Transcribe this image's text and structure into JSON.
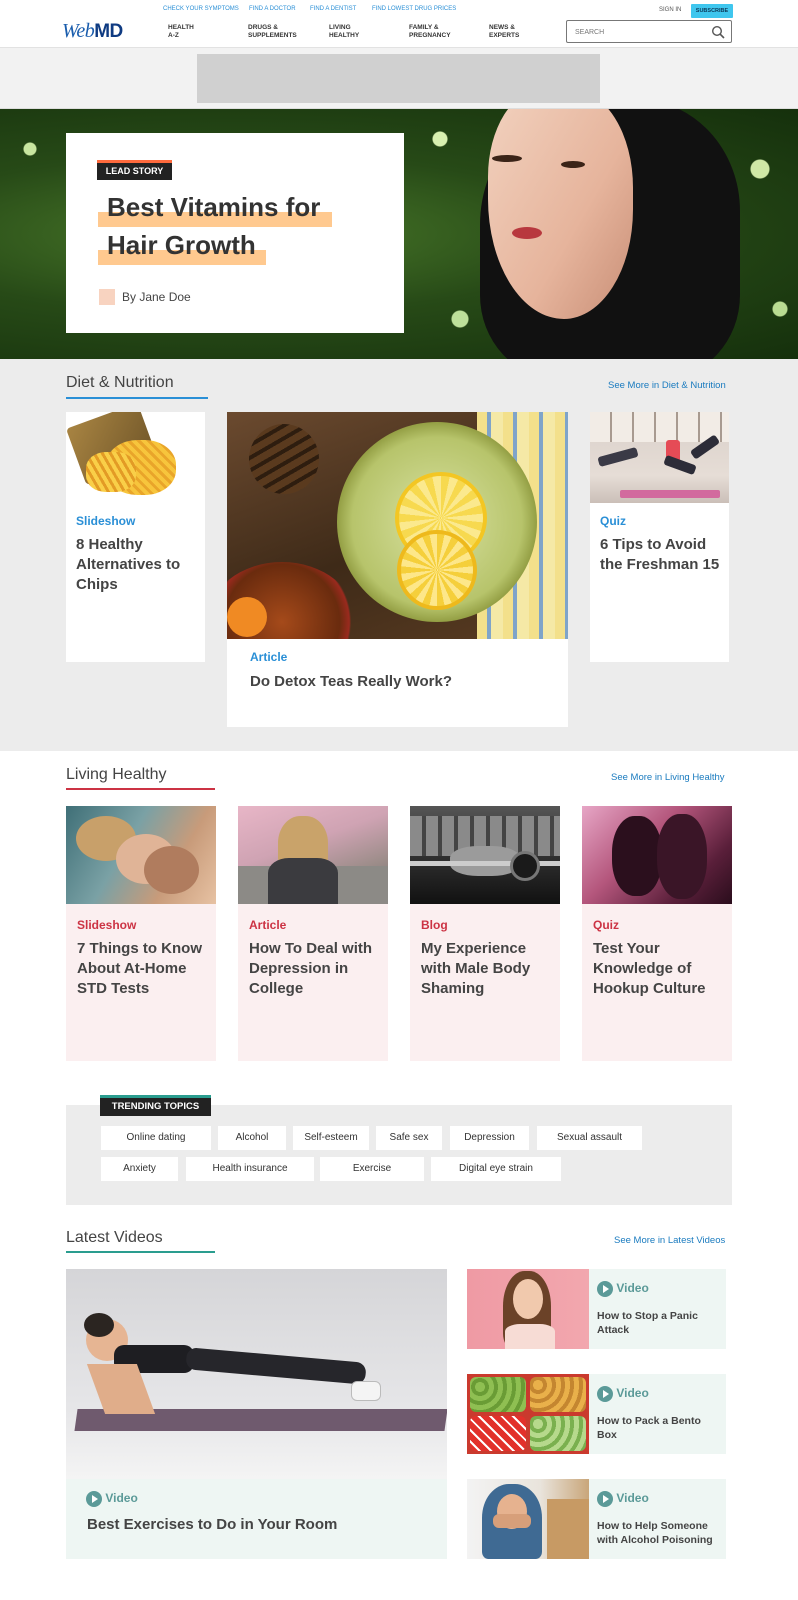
{
  "header": {
    "logo_web": "Web",
    "logo_md": "MD",
    "top_links": [
      "CHECK YOUR SYMPTOMS",
      "FIND A DOCTOR",
      "FIND A DENTIST",
      "FIND LOWEST DRUG PRICES"
    ],
    "sign_in": "SIGN IN",
    "subscribe": "SUBSCRIBE",
    "nav": [
      "HEALTH\nA-Z",
      "DRUGS &\nSUPPLEMENTS",
      "LIVING\nHEALTHY",
      "FAMILY &\nPREGNANCY",
      "NEWS &\nEXPERTS"
    ],
    "search_placeholder": "SEARCH"
  },
  "hero": {
    "tag": "LEAD STORY",
    "headline": "Best Vitamins for Hair Growth",
    "byline": "By Jane Doe"
  },
  "diet": {
    "title": "Diet & Nutrition",
    "see_more": "See More in Diet & Nutrition",
    "accent": "#2a8fd6",
    "cards": [
      {
        "type": "Slideshow",
        "title": "8 Healthy Alternatives to Chips"
      },
      {
        "type": "Article",
        "title": "Do Detox Teas Really Work?"
      },
      {
        "type": "Quiz",
        "title": "6 Tips to Avoid the Freshman 15"
      }
    ]
  },
  "living": {
    "title": "Living Healthy",
    "see_more": "See More in Living Healthy",
    "accent": "#cc3344",
    "cards": [
      {
        "type": "Slideshow",
        "title": "7 Things to Know About At-Home STD Tests"
      },
      {
        "type": "Article",
        "title": "How To Deal with Depression in College"
      },
      {
        "type": "Blog",
        "title": "My Experience with Male Body Shaming"
      },
      {
        "type": "Quiz",
        "title": "Test Your Knowledge of Hookup Culture"
      }
    ]
  },
  "trending": {
    "tag": "TRENDING TOPICS",
    "topics": [
      "Online dating",
      "Alcohol",
      "Self-esteem",
      "Safe sex",
      "Depression",
      "Sexual assault",
      "Anxiety",
      "Health insurance",
      "Exercise",
      "Digital eye strain"
    ]
  },
  "videos": {
    "title": "Latest Videos",
    "see_more": "See More in Latest Videos",
    "accent": "#2a9d8f",
    "type_label": "Video",
    "main": {
      "title": "Best Exercises to Do in Your Room"
    },
    "side": [
      {
        "title": "How to Stop a Panic Attack"
      },
      {
        "title": "How to Pack a Bento Box"
      },
      {
        "title": "How to Help Someone with Alcohol Poisoning"
      }
    ]
  }
}
